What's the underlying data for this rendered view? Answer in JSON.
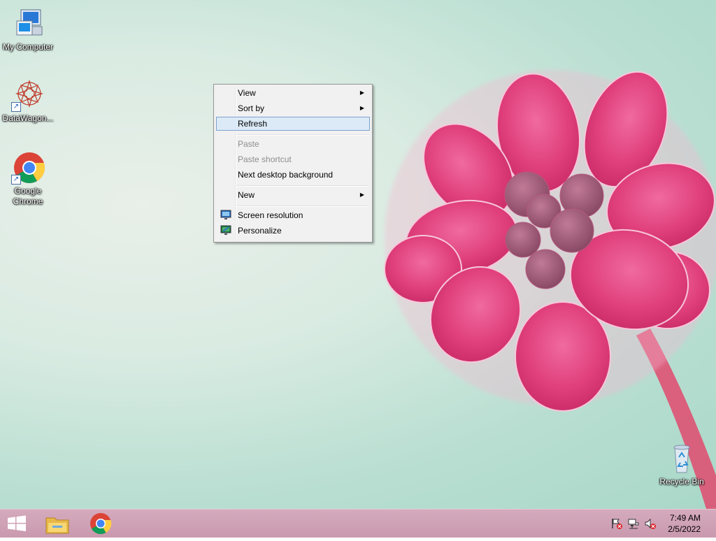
{
  "desktop_icons": [
    {
      "label": "My Computer",
      "icon": "computer-icon"
    },
    {
      "label": "DataWagon...",
      "icon": "datawagon-icon"
    },
    {
      "label": "Google Chrome",
      "line1": "Google",
      "line2": "Chrome",
      "icon": "chrome-icon"
    },
    {
      "label": "Recycle Bin",
      "icon": "recycle-bin-icon"
    }
  ],
  "context_menu": {
    "items": [
      {
        "label": "View",
        "submenu": true,
        "enabled": true
      },
      {
        "label": "Sort by",
        "submenu": true,
        "enabled": true
      },
      {
        "label": "Refresh",
        "submenu": false,
        "enabled": true,
        "highlighted": true
      },
      {
        "label": "Paste",
        "submenu": false,
        "enabled": false
      },
      {
        "label": "Paste shortcut",
        "submenu": false,
        "enabled": false
      },
      {
        "label": "Next desktop background",
        "submenu": false,
        "enabled": true
      },
      {
        "label": "New",
        "submenu": true,
        "enabled": true
      },
      {
        "label": "Screen resolution",
        "submenu": false,
        "enabled": true,
        "icon": "screen-resolution-icon"
      },
      {
        "label": "Personalize",
        "submenu": false,
        "enabled": true,
        "icon": "personalize-icon"
      }
    ],
    "submenu_arrow": "▶"
  },
  "taskbar": {
    "start_icon": "windows-logo-icon",
    "pinned": [
      "file-explorer-icon",
      "chrome-icon"
    ],
    "tray_icons": [
      "action-center-flag-icon",
      "network-icon",
      "volume-muted-icon"
    ],
    "clock": {
      "time": "7:49 AM",
      "date": "2/5/2022"
    }
  },
  "colors": {
    "taskbar": "#cfa2b7",
    "menu_highlight": "#dceaf7",
    "flower": "#e0457f"
  }
}
